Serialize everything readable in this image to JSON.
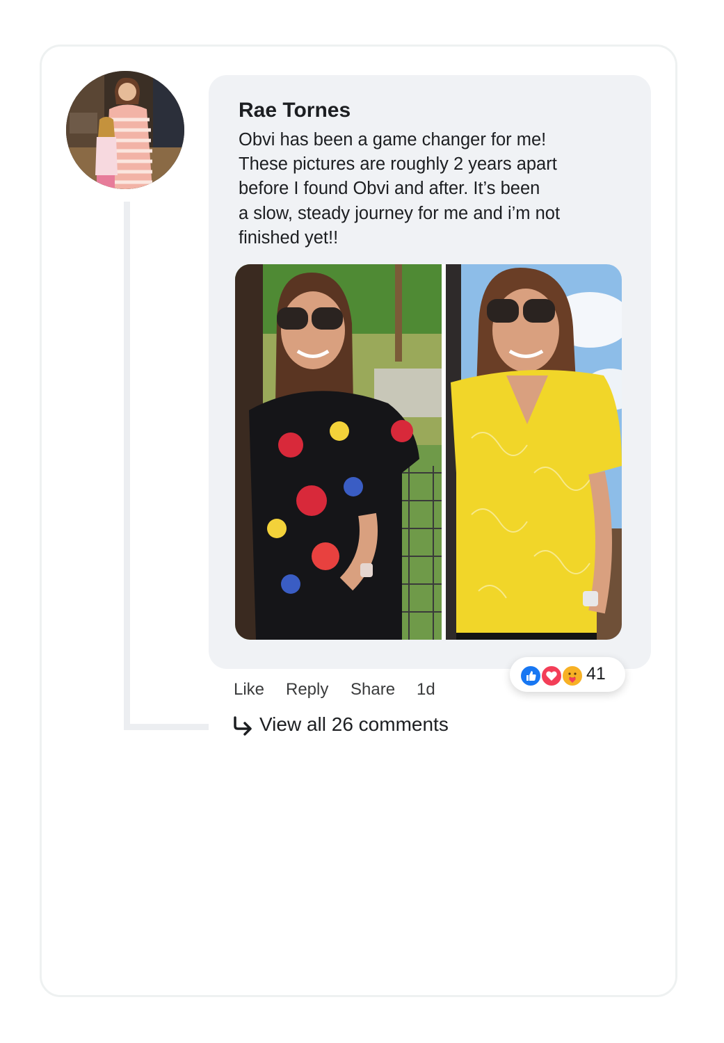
{
  "post": {
    "author": "Rae Tornes",
    "comment_lines": [
      "Obvi has been a game changer for me!",
      "These pictures are roughly 2 years apart",
      "before I found Obvi and after. It’s been",
      "a slow, steady journey for me and i’m not",
      "finished yet!!"
    ],
    "reactions": {
      "icons": [
        "like-icon",
        "love-icon",
        "care-icon"
      ],
      "count": "41"
    },
    "actions": {
      "like": "Like",
      "reply": "Reply",
      "share": "Share",
      "time": "1d"
    },
    "view_all": "View all 26 comments"
  },
  "colors": {
    "bubble": "#f0f2f5",
    "like_blue": "#1877f2",
    "love_red": "#f33e58",
    "care_yellow": "#f7b125",
    "text": "#1c1e21"
  }
}
